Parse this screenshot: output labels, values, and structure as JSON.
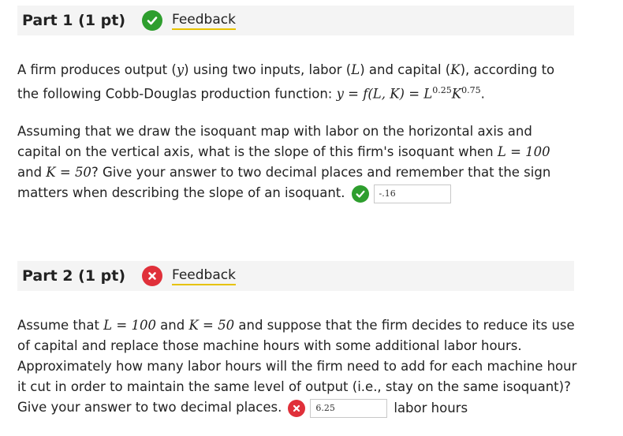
{
  "colors": {
    "correct": "#2e9e2e",
    "incorrect": "#e0303a",
    "header_bg": "#f4f4f4",
    "feedback_underline": "#e6c200"
  },
  "part1": {
    "title": "Part 1 (1 pt)",
    "status_icon": "check-icon",
    "feedback_label": "Feedback",
    "intro_text_1": "A firm produces output (",
    "var_y": "y",
    "intro_text_2": ") using two inputs, labor (",
    "var_L": "L",
    "intro_text_3": ") and capital (",
    "var_K": "K",
    "intro_text_4": "), according to the following Cobb-Douglas production function: ",
    "function_expr": "y = f(L, K) = L",
    "exp_L": "0.25",
    "function_K": "K",
    "exp_K": "0.75",
    "function_end": ".",
    "question_1": "Assuming that we draw the isoquant map with labor on the horizontal axis and capital on the vertical axis, what is the slope of this firm's isoquant when ",
    "cond_L": "L = 100",
    "and_word": " and ",
    "cond_K": "K = 50",
    "question_2": "? Give your answer to two decimal places and remember that the sign matters when describing the slope of an isoquant.",
    "answer_value": "-.16"
  },
  "part2": {
    "title": "Part 2 (1 pt)",
    "status_icon": "x-icon",
    "feedback_label": "Feedback",
    "question_1": "Assume that ",
    "cond_L": "L = 100",
    "and_word": " and ",
    "cond_K": "K = 50",
    "question_2": " and suppose that the firm decides to reduce its use of capital and replace those machine hours with some additional labor hours. Approximately how many labor hours will the firm need to add for each machine hour it cut in order to maintain the same level of output (i.e., stay on the same isoquant)? Give your answer to two decimal places.",
    "answer_value": "6.25",
    "unit_label": "labor hours"
  }
}
